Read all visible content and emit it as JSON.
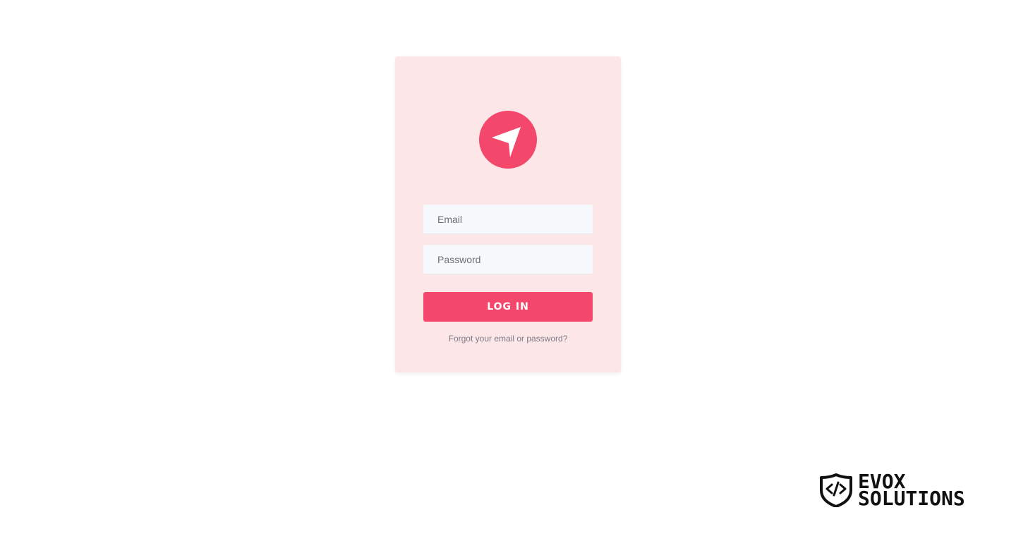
{
  "colors": {
    "accent": "#f4476c",
    "card_background": "#fde6e8",
    "input_background": "#f7f8fb"
  },
  "logo": {
    "icon": "navigation-arrow-icon"
  },
  "form": {
    "email_placeholder": "Email",
    "password_placeholder": "Password",
    "login_label": "LOG IN",
    "forgot_label": "Forgot your email or password?"
  },
  "brand": {
    "icon": "code-shield-icon",
    "line1": "EVOX",
    "line2": "SOLUTIONS"
  }
}
